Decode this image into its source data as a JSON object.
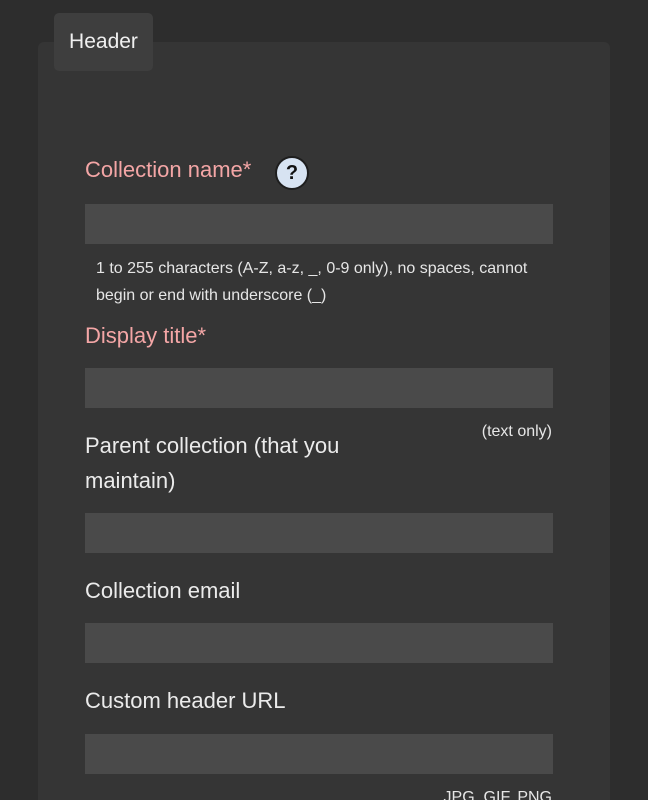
{
  "header": {
    "tab_label": "Header"
  },
  "form": {
    "collection_name": {
      "label": "Collection name*",
      "help_icon": "question-mark-icon",
      "value": "",
      "hint": "1 to 255 characters (A-Z, a-z, _, 0-9 only), no spaces, cannot begin or end with underscore (_)"
    },
    "display_title": {
      "label": "Display title*",
      "value": "",
      "note": "(text only)"
    },
    "parent_collection": {
      "label_line1": "Parent collection (that you",
      "label_line2": "maintain)",
      "value": ""
    },
    "collection_email": {
      "label": "Collection email",
      "value": ""
    },
    "custom_header_url": {
      "label": "Custom header URL",
      "value": "",
      "note": ".JPG, GIF, PNG"
    }
  },
  "colors": {
    "background": "#2d2d2d",
    "panel": "#353535",
    "field": "#4a4a4a",
    "required_label": "#f4a6a6",
    "label": "#ebebeb",
    "help_icon": "#d7e3f2"
  }
}
